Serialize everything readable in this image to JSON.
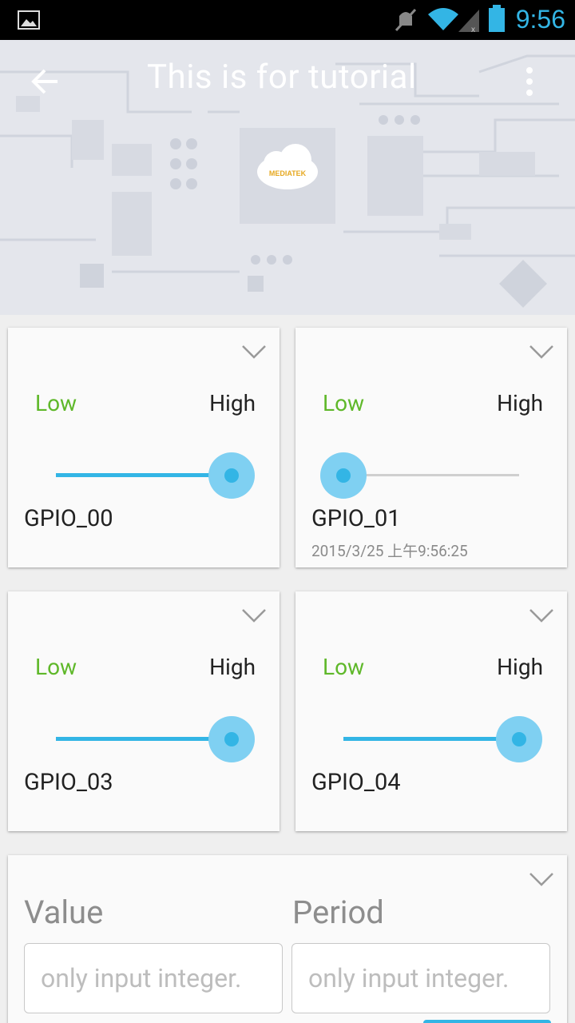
{
  "status_bar": {
    "time": "9:56"
  },
  "header": {
    "title": "This is for tutorial"
  },
  "gpio_cards": [
    {
      "name": "GPIO_00",
      "low_label": "Low",
      "high_label": "High",
      "level": 1,
      "timestamp": ""
    },
    {
      "name": "GPIO_01",
      "low_label": "Low",
      "high_label": "High",
      "level": 0,
      "timestamp": "2015/3/25 上午9:56:25"
    },
    {
      "name": "GPIO_03",
      "low_label": "Low",
      "high_label": "High",
      "level": 1,
      "timestamp": ""
    },
    {
      "name": "GPIO_04",
      "low_label": "Low",
      "high_label": "High",
      "level": 1,
      "timestamp": ""
    }
  ],
  "pwm": {
    "value_label": "Value",
    "period_label": "Period",
    "value_placeholder": "only input integer.",
    "period_placeholder": "only input integer."
  },
  "colors": {
    "accent": "#33b5e5",
    "low_text": "#5fb82a",
    "status_bar": "#000000"
  }
}
